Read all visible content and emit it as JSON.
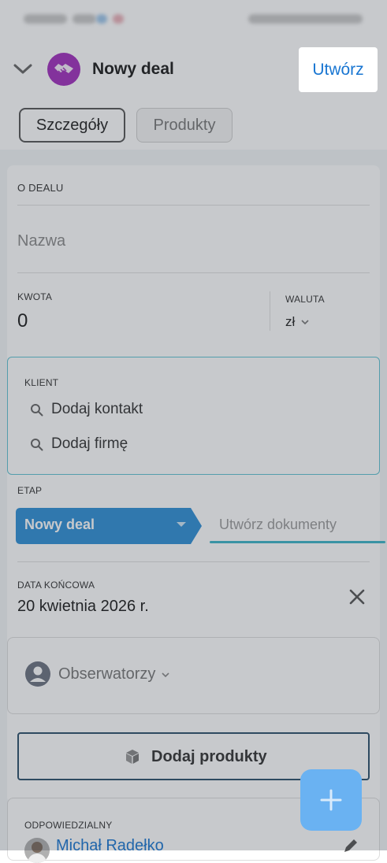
{
  "header": {
    "title": "Nowy deal",
    "create_label": "Utwórz"
  },
  "tabs": [
    {
      "label": "Szczegóły",
      "active": true
    },
    {
      "label": "Produkty",
      "active": false
    }
  ],
  "about": {
    "section_label": "O DEALU",
    "name_placeholder": "Nazwa",
    "amount_label": "KWOTA",
    "amount_value": "0",
    "currency_label": "WALUTA",
    "currency_value": "zł"
  },
  "client": {
    "label": "KLIENT",
    "add_contact": "Dodaj kontakt",
    "add_company": "Dodaj firmę"
  },
  "stage": {
    "label": "ETAP",
    "current": "Nowy deal",
    "documents": "Utwórz dokumenty"
  },
  "end_date": {
    "label": "DATA KOŃCOWA",
    "value": "20 kwietnia 2026 r."
  },
  "observers": {
    "label": "Obserwatorzy"
  },
  "products": {
    "add_label": "Dodaj produkty"
  },
  "responsible": {
    "label": "ODPOWIEDZIALNY",
    "name": "Michał Radełko"
  },
  "colors": {
    "accent": "#1976d2",
    "stage": "#2e8fd6",
    "deal_icon": "#a12fbd",
    "client_border": "#5fc3d3",
    "fab": "#6ab2f2"
  },
  "icons": {
    "collapse": "chevron-down-icon",
    "deal": "handshake-icon",
    "search": "search-icon",
    "close": "close-icon",
    "avatar": "user-avatar-icon",
    "box": "box-icon",
    "add": "plus-icon",
    "edit": "pencil-icon"
  }
}
